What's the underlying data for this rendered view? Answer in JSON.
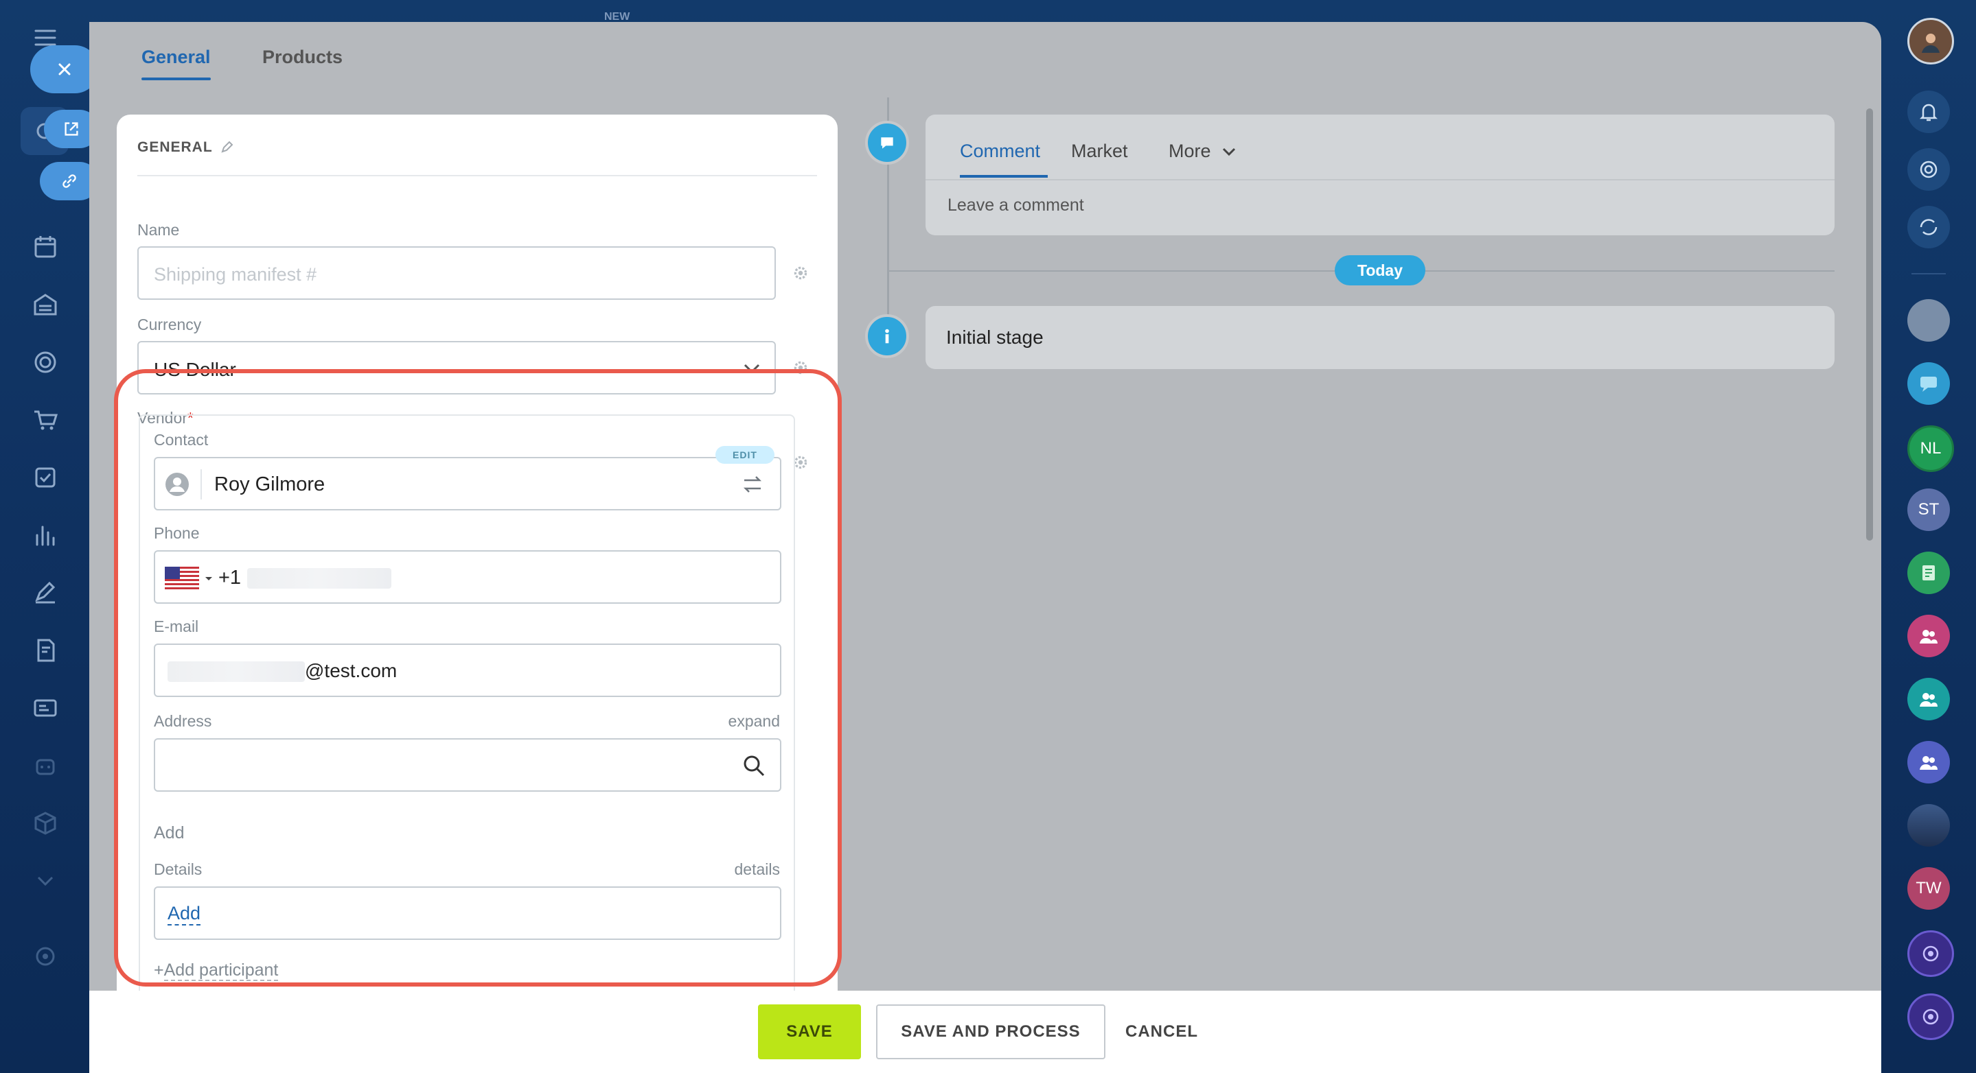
{
  "header": {
    "new_badge": "NEW"
  },
  "tabs": [
    {
      "label": "General"
    },
    {
      "label": "Products"
    }
  ],
  "general": {
    "section_title": "GENERAL",
    "name_label": "Name",
    "name_placeholder": "Shipping manifest #",
    "currency_label": "Currency",
    "currency_value": "US Dollar",
    "vendor_label": "Vendor",
    "vendor_required_mark": "*",
    "contact_label": "Contact",
    "edit_badge": "EDIT",
    "contact_name": "Roy Gilmore",
    "phone_label": "Phone",
    "phone_prefix": "+1",
    "email_label": "E-mail",
    "email_suffix": "@test.com",
    "address_label": "Address",
    "address_expand": "expand",
    "address_add": "Add",
    "details_label": "Details",
    "details_link": "details",
    "details_add": "Add",
    "add_participant": "Add participant",
    "add_participant_plus": "+"
  },
  "timeline": {
    "tabs": [
      {
        "label": "Comment"
      },
      {
        "label": "Market"
      },
      {
        "label": "More"
      }
    ],
    "comment_placeholder": "Leave a comment",
    "today_badge": "Today",
    "stage_text": "Initial stage"
  },
  "footer": {
    "save": "SAVE",
    "save_process": "SAVE AND PROCESS",
    "cancel": "CANCEL"
  },
  "right_sidebar": {
    "avatars": [
      {
        "initials": "NL"
      },
      {
        "initials": "ST"
      },
      {
        "initials": "TW"
      }
    ]
  },
  "colors": {
    "accent": "#2067b0",
    "save_button": "#bbe517",
    "highlight": "#ea5a4c",
    "badge": "#2fa6dc"
  }
}
